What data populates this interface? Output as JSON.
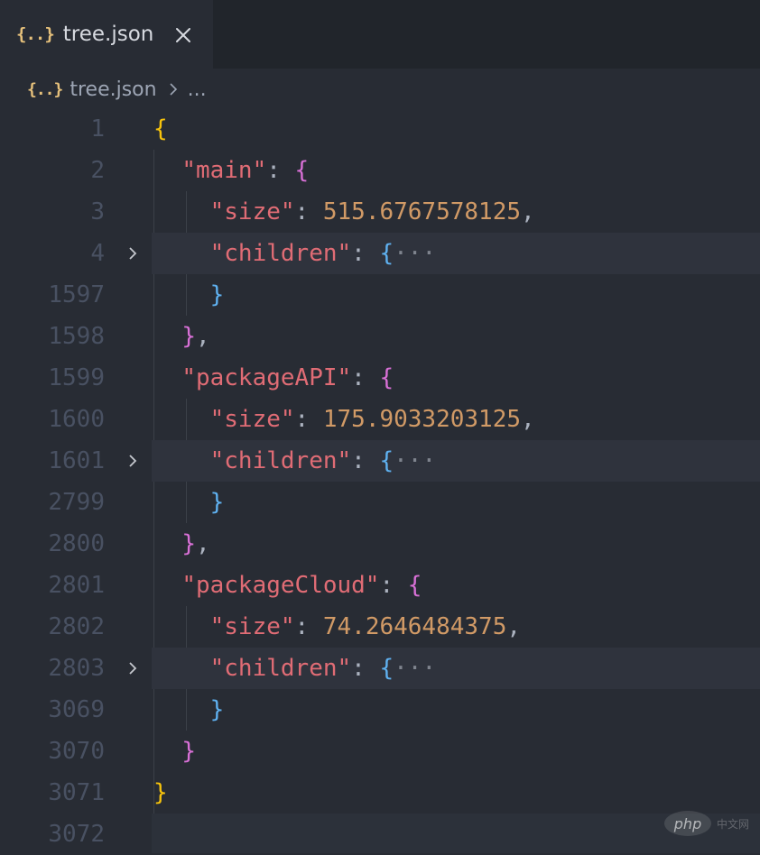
{
  "tab": {
    "title": "tree.json",
    "icon": "json-file-icon"
  },
  "breadcrumb": {
    "file": "tree.json",
    "more": "..."
  },
  "lines": [
    {
      "ln": "1",
      "folded": false,
      "tokens": [
        [
          "{",
          "b1"
        ]
      ]
    },
    {
      "ln": "2",
      "folded": false,
      "tokens": [
        [
          "  ",
          ""
        ],
        [
          "\"main\"",
          "str"
        ],
        [
          ": ",
          "pun"
        ],
        [
          "{",
          "b2"
        ]
      ]
    },
    {
      "ln": "3",
      "folded": false,
      "tokens": [
        [
          "    ",
          ""
        ],
        [
          "\"size\"",
          "str"
        ],
        [
          ": ",
          "pun"
        ],
        [
          "515.6767578125",
          "num"
        ],
        [
          ",",
          "pun"
        ]
      ]
    },
    {
      "ln": "4",
      "folded": true,
      "tokens": [
        [
          "    ",
          ""
        ],
        [
          "\"children\"",
          "str"
        ],
        [
          ": ",
          "pun"
        ],
        [
          "{",
          "b3"
        ],
        [
          "···",
          "dots"
        ]
      ]
    },
    {
      "ln": "1597",
      "folded": false,
      "tokens": [
        [
          "    ",
          ""
        ],
        [
          "}",
          "b3"
        ]
      ]
    },
    {
      "ln": "1598",
      "folded": false,
      "tokens": [
        [
          "  ",
          ""
        ],
        [
          "}",
          "b2"
        ],
        [
          ",",
          "pun"
        ]
      ]
    },
    {
      "ln": "1599",
      "folded": false,
      "tokens": [
        [
          "  ",
          ""
        ],
        [
          "\"packageAPI\"",
          "str"
        ],
        [
          ": ",
          "pun"
        ],
        [
          "{",
          "b2"
        ]
      ]
    },
    {
      "ln": "1600",
      "folded": false,
      "tokens": [
        [
          "    ",
          ""
        ],
        [
          "\"size\"",
          "str"
        ],
        [
          ": ",
          "pun"
        ],
        [
          "175.9033203125",
          "num"
        ],
        [
          ",",
          "pun"
        ]
      ]
    },
    {
      "ln": "1601",
      "folded": true,
      "tokens": [
        [
          "    ",
          ""
        ],
        [
          "\"children\"",
          "str"
        ],
        [
          ": ",
          "pun"
        ],
        [
          "{",
          "b3"
        ],
        [
          "···",
          "dots"
        ]
      ]
    },
    {
      "ln": "2799",
      "folded": false,
      "tokens": [
        [
          "    ",
          ""
        ],
        [
          "}",
          "b3"
        ]
      ]
    },
    {
      "ln": "2800",
      "folded": false,
      "tokens": [
        [
          "  ",
          ""
        ],
        [
          "}",
          "b2"
        ],
        [
          ",",
          "pun"
        ]
      ]
    },
    {
      "ln": "2801",
      "folded": false,
      "tokens": [
        [
          "  ",
          ""
        ],
        [
          "\"packageCloud\"",
          "str"
        ],
        [
          ": ",
          "pun"
        ],
        [
          "{",
          "b2"
        ]
      ]
    },
    {
      "ln": "2802",
      "folded": false,
      "tokens": [
        [
          "    ",
          ""
        ],
        [
          "\"size\"",
          "str"
        ],
        [
          ": ",
          "pun"
        ],
        [
          "74.2646484375",
          "num"
        ],
        [
          ",",
          "pun"
        ]
      ]
    },
    {
      "ln": "2803",
      "folded": true,
      "tokens": [
        [
          "    ",
          ""
        ],
        [
          "\"children\"",
          "str"
        ],
        [
          ": ",
          "pun"
        ],
        [
          "{",
          "b3"
        ],
        [
          "···",
          "dots"
        ]
      ]
    },
    {
      "ln": "3069",
      "folded": false,
      "tokens": [
        [
          "    ",
          ""
        ],
        [
          "}",
          "b3"
        ]
      ]
    },
    {
      "ln": "3070",
      "folded": false,
      "tokens": [
        [
          "  ",
          ""
        ],
        [
          "}",
          "b2"
        ]
      ]
    },
    {
      "ln": "3071",
      "folded": false,
      "tokens": [
        [
          "}",
          "b1"
        ]
      ]
    },
    {
      "ln": "3072",
      "folded": false,
      "tokens": []
    }
  ],
  "watermark": {
    "logo": "php",
    "text": "中文网"
  },
  "colors": {
    "background": "#282c34",
    "string": "#e06c75",
    "number": "#d19a66",
    "bracket_level1": "#f7c30c",
    "bracket_level2": "#d870d6",
    "bracket_level3": "#5fb1f0"
  }
}
